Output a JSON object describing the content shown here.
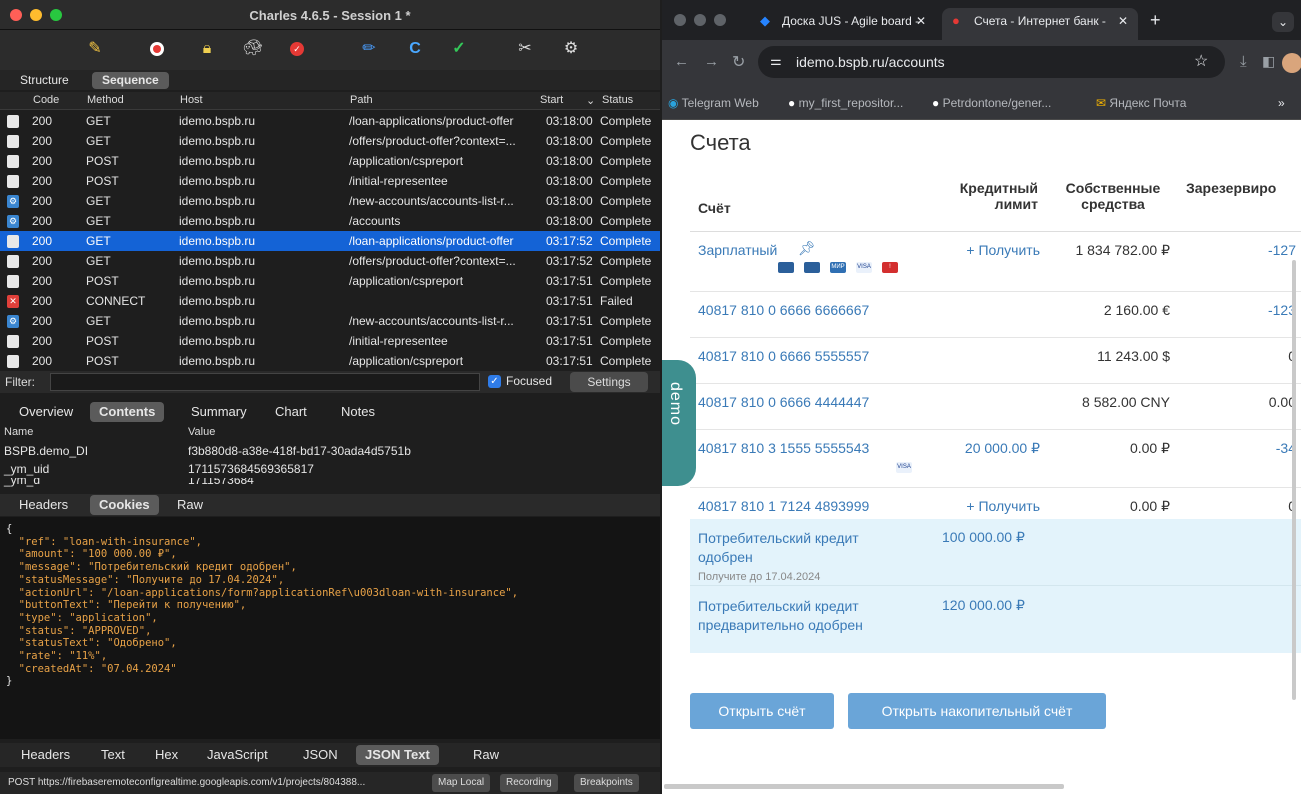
{
  "charles": {
    "title": "Charles 4.6.5 - Session 1 *",
    "view_tabs": [
      "Structure",
      "Sequence"
    ],
    "columns": {
      "code": "Code",
      "method": "Method",
      "host": "Host",
      "path": "Path",
      "start": "Start",
      "status": "Status"
    },
    "rows": [
      {
        "icon": "doc",
        "code": "200",
        "method": "GET",
        "host": "idemo.bspb.ru",
        "path": "/loan-applications/product-offer",
        "start": "03:18:00",
        "status": "Complete"
      },
      {
        "icon": "doc",
        "code": "200",
        "method": "GET",
        "host": "idemo.bspb.ru",
        "path": "/offers/product-offer?context=...",
        "start": "03:18:00",
        "status": "Complete"
      },
      {
        "icon": "doc",
        "code": "200",
        "method": "POST",
        "host": "idemo.bspb.ru",
        "path": "/application/cspreport",
        "start": "03:18:00",
        "status": "Complete"
      },
      {
        "icon": "doc",
        "code": "200",
        "method": "POST",
        "host": "idemo.bspb.ru",
        "path": "/initial-representee",
        "start": "03:18:00",
        "status": "Complete"
      },
      {
        "icon": "js",
        "code": "200",
        "method": "GET",
        "host": "idemo.bspb.ru",
        "path": "/new-accounts/accounts-list-r...",
        "start": "03:18:00",
        "status": "Complete"
      },
      {
        "icon": "js",
        "code": "200",
        "method": "GET",
        "host": "idemo.bspb.ru",
        "path": "/accounts",
        "start": "03:18:00",
        "status": "Complete"
      },
      {
        "icon": "doc",
        "code": "200",
        "method": "GET",
        "host": "idemo.bspb.ru",
        "path": "/loan-applications/product-offer",
        "start": "03:17:52",
        "status": "Complete",
        "selected": true
      },
      {
        "icon": "doc",
        "code": "200",
        "method": "GET",
        "host": "idemo.bspb.ru",
        "path": "/offers/product-offer?context=...",
        "start": "03:17:52",
        "status": "Complete"
      },
      {
        "icon": "doc",
        "code": "200",
        "method": "POST",
        "host": "idemo.bspb.ru",
        "path": "/application/cspreport",
        "start": "03:17:51",
        "status": "Complete"
      },
      {
        "icon": "fail",
        "code": "200",
        "method": "CONNECT",
        "host": "idemo.bspb.ru",
        "path": "",
        "start": "03:17:51",
        "status": "Failed"
      },
      {
        "icon": "js",
        "code": "200",
        "method": "GET",
        "host": "idemo.bspb.ru",
        "path": "/new-accounts/accounts-list-r...",
        "start": "03:17:51",
        "status": "Complete"
      },
      {
        "icon": "doc",
        "code": "200",
        "method": "POST",
        "host": "idemo.bspb.ru",
        "path": "/initial-representee",
        "start": "03:17:51",
        "status": "Complete"
      },
      {
        "icon": "doc",
        "code": "200",
        "method": "POST",
        "host": "idemo.bspb.ru",
        "path": "/application/cspreport",
        "start": "03:17:51",
        "status": "Complete"
      }
    ],
    "filter_label": "Filter:",
    "focused_label": "Focused",
    "settings_label": "Settings",
    "detail_tabs": [
      "Overview",
      "Contents",
      "Summary",
      "Chart",
      "Notes"
    ],
    "kv_header": {
      "name": "Name",
      "value": "Value"
    },
    "kv_rows": [
      {
        "name": "BSPB.demo_DI",
        "value": "f3b880d8-a38e-418f-bd17-30ada4d5751b"
      },
      {
        "name": "_ym_uid",
        "value": "1711573684569365817"
      },
      {
        "name": "_ym_d",
        "value": "1711573684"
      }
    ],
    "request_tabs": [
      "Headers",
      "Cookies",
      "Raw"
    ],
    "json_lines": [
      "{",
      "  \"ref\": \"loan-with-insurance\",",
      "  \"amount\": \"100 000.00 ₽\",",
      "  \"message\": \"Потребительский кредит одобрен\",",
      "  \"statusMessage\": \"Получите до 17.04.2024\",",
      "  \"actionUrl\": \"/loan-applications/form?applicationRef\\u003dloan-with-insurance\",",
      "  \"buttonText\": \"Перейти к получению\",",
      "  \"type\": \"application\",",
      "  \"status\": \"APPROVED\",",
      "  \"statusText\": \"Одобрено\",",
      "  \"rate\": \"11%\",",
      "  \"createdAt\": \"07.04.2024\"",
      "}"
    ],
    "response_tabs": [
      "Headers",
      "Text",
      "Hex",
      "JavaScript",
      "JSON",
      "JSON Text",
      "Raw"
    ],
    "status_url": "POST https://firebaseremoteconfigrealtime.googleapis.com/v1/projects/804388...",
    "status_buttons": [
      "Map Local",
      "Recording",
      "Breakpoints"
    ]
  },
  "chrome": {
    "tabs": [
      {
        "title": "Доска JUS - Agile board -"
      },
      {
        "title": "Счета - Интернет банк -"
      }
    ],
    "url": "idemo.bspb.ru/accounts",
    "bookmarks": [
      "Telegram Web",
      "my_first_repositor...",
      "Petrdontone/gener...",
      "Яндекс Почта"
    ],
    "bookmarks_more": "»"
  },
  "bank": {
    "heading": "Счета",
    "side_tab": "demo",
    "col_account": "Счёт",
    "col_credit": "Кредитный лимит",
    "col_own": "Собственные средства",
    "col_reserved": "Зарезервиро",
    "accounts": [
      {
        "name": "Зарплатный",
        "credit": "+ Получить",
        "own": "1 834 782.00 ₽",
        "reserved": "-127",
        "cards": [
          "card",
          "card",
          "МИР",
          "VISA",
          "!"
        ]
      },
      {
        "name": "40817 810 0 6666 6666667",
        "credit": "",
        "own": "2 160.00 €",
        "reserved": "-123"
      },
      {
        "name": "40817 810 0 6666 5555557",
        "credit": "",
        "own": "11 243.00 $",
        "reserved": "0"
      },
      {
        "name": "40817 810 0 6666 4444447",
        "credit": "",
        "own": "8 582.00 CNY",
        "reserved": "0.00"
      },
      {
        "name": "40817 810 3 1555 5555543",
        "credit": "20 000.00 ₽",
        "own": "0.00 ₽",
        "reserved": "-34",
        "cards": [
          "VISA"
        ]
      },
      {
        "name": "40817 810 1 7124 4893999",
        "credit": "+ Получить",
        "own": "0.00 ₽",
        "reserved": "0"
      }
    ],
    "loans": [
      {
        "name": "Потребительский кредит одобрен",
        "sub": "Получите до 17.04.2024",
        "amount": "100 000.00 ₽"
      },
      {
        "name": "Потребительский кредит предварительно одобрен",
        "sub": "",
        "amount": "120 000.00 ₽"
      }
    ],
    "open_account": "Открыть счёт",
    "open_savings": "Открыть накопительный счёт"
  }
}
